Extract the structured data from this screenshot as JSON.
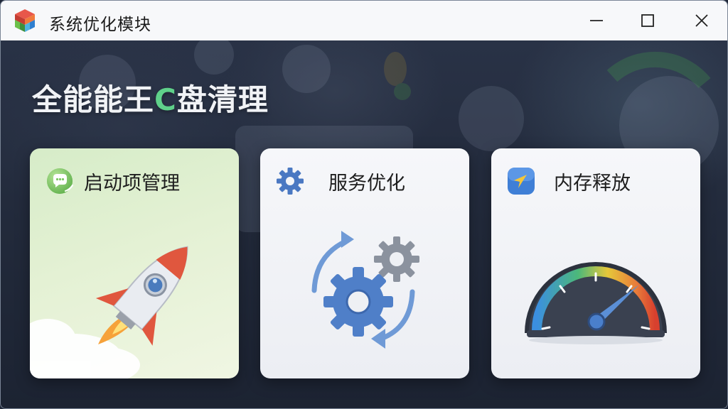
{
  "window": {
    "title": "系统优化模块",
    "app_icon": "stacked-cube-icon",
    "controls": [
      "minimize-icon",
      "maximize-icon",
      "close-icon"
    ]
  },
  "hero": {
    "prefix": "全能能王",
    "accent": "C",
    "suffix": "盘清理",
    "accent_color": "#5fd18a"
  },
  "cards": [
    {
      "label": "启动项管理",
      "icon": "chat-bubble-icon",
      "illustration": "rocket-launch-illustration"
    },
    {
      "label": "服务优化",
      "icon": "gear-icon",
      "illustration": "gears-refresh-illustration"
    },
    {
      "label": "内存释放",
      "icon": "compass-arrow-icon",
      "illustration": "speedometer-gauge-illustration"
    }
  ],
  "colors": {
    "titlebar_bg": "#f7f8fa",
    "content_bg": "#222a3b",
    "card1_bg": "#e4f1d4",
    "card_bg": "#f0f2f6",
    "gear_blue": "#4a78c2"
  }
}
